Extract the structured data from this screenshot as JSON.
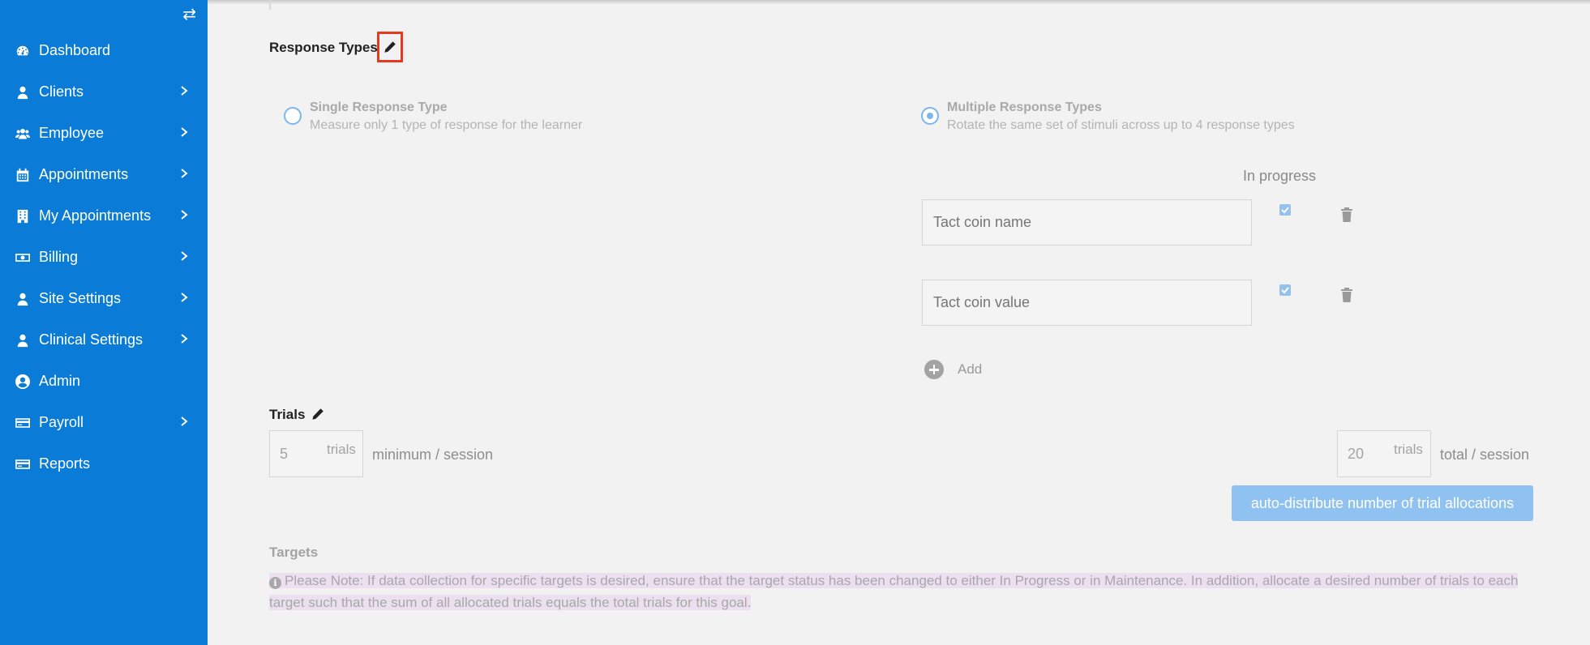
{
  "sidebar": {
    "toggle_icon": "swap-arrows-icon",
    "items": [
      {
        "label": "Dashboard",
        "icon": "dashboard-icon",
        "has_submenu": false
      },
      {
        "label": "Clients",
        "icon": "user-icon",
        "has_submenu": true
      },
      {
        "label": "Employee",
        "icon": "users-icon",
        "has_submenu": true
      },
      {
        "label": "Appointments",
        "icon": "calendar-icon",
        "has_submenu": true
      },
      {
        "label": "My Appointments",
        "icon": "building-icon",
        "has_submenu": true
      },
      {
        "label": "Billing",
        "icon": "money-icon",
        "has_submenu": true
      },
      {
        "label": "Site Settings",
        "icon": "user-icon",
        "has_submenu": true
      },
      {
        "label": "Clinical Settings",
        "icon": "user-icon",
        "has_submenu": true
      },
      {
        "label": "Admin",
        "icon": "user-circle-icon",
        "has_submenu": false
      },
      {
        "label": "Payroll",
        "icon": "credit-card-icon",
        "has_submenu": true
      },
      {
        "label": "Reports",
        "icon": "credit-card-icon",
        "has_submenu": false
      }
    ]
  },
  "response_types": {
    "title": "Response Types",
    "single": {
      "title": "Single Response Type",
      "subtitle": "Measure only 1 type of response for the learner",
      "selected": false
    },
    "multiple": {
      "title": "Multiple Response Types",
      "subtitle": "Rotate the same set of stimuli across up to 4 response types",
      "selected": true
    },
    "column_header": "In progress",
    "rows": [
      {
        "placeholder": "Tact coin name",
        "in_progress": true
      },
      {
        "placeholder": "Tact coin value",
        "in_progress": true
      }
    ],
    "add_label": "Add"
  },
  "trials": {
    "title": "Trials",
    "minimum_value": "5",
    "minimum_unit": "trials",
    "minimum_suffix": "minimum / session",
    "total_value": "20",
    "total_unit": "trials",
    "total_suffix": "total / session",
    "auto_button": "auto-distribute number of trial allocations"
  },
  "targets": {
    "title": "Targets",
    "note": "Please Note: If data collection for specific targets is desired, ensure that the target status has been changed to either In Progress or in Maintenance. In addition, allocate a desired number of trials to each target such that the sum of all allocated trials equals the total trials for this goal."
  },
  "colors": {
    "sidebar_bg": "#0a7bd6",
    "page_bg": "#f2f2f2",
    "highlight_border": "#e8391f",
    "button_bg": "#8fc2f1",
    "note_highlight": "#ecdff0"
  }
}
